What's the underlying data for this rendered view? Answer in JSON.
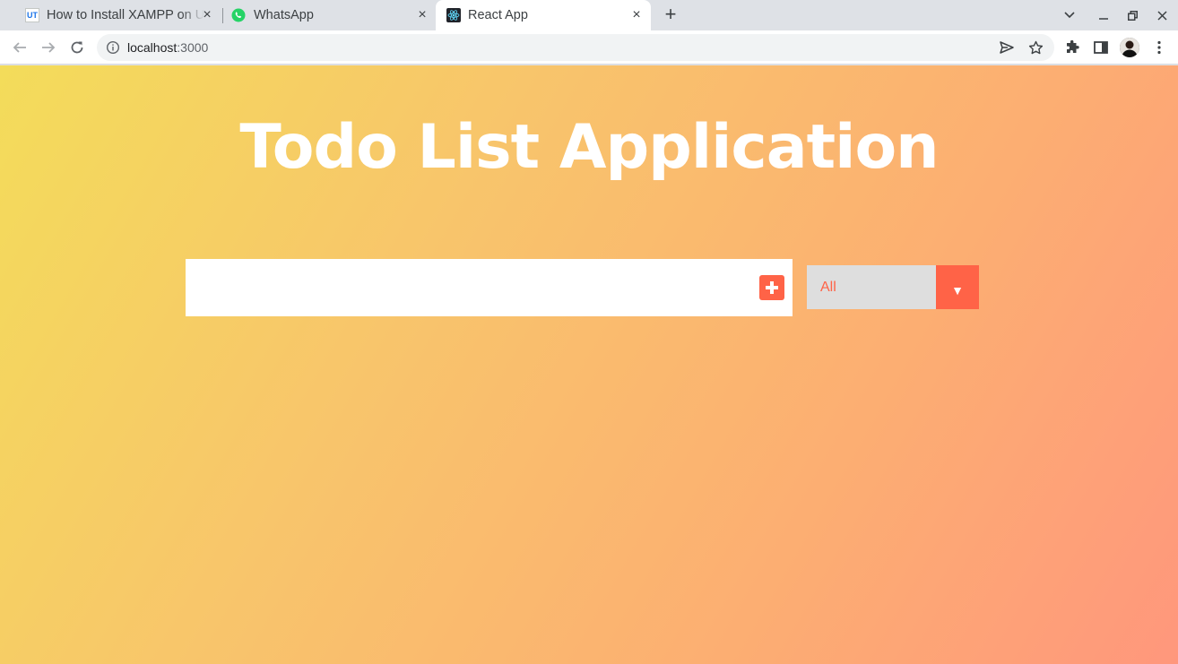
{
  "browser": {
    "tabs": [
      {
        "title": "How to Install XAMPP on Ubuntu",
        "favicon": "ut-icon",
        "active": false
      },
      {
        "title": "WhatsApp",
        "favicon": "whatsapp-icon",
        "active": false
      },
      {
        "title": "React App",
        "favicon": "react-icon",
        "active": true
      }
    ],
    "new_tab_symbol": "+",
    "close_symbol": "×",
    "address": {
      "host": "localhost",
      "port": ":3000"
    },
    "ut_favicon_text": "UT"
  },
  "app": {
    "title": "Todo List Application",
    "input": {
      "value": "",
      "placeholder": ""
    },
    "add_button_icon": "plus-square-icon",
    "filter": {
      "selected": "All",
      "arrow": "▼"
    },
    "colors": {
      "accent": "#ff6347",
      "gradient_start": "#f3dc5a",
      "gradient_end": "#ff977c",
      "select_bg": "#dedede"
    }
  }
}
